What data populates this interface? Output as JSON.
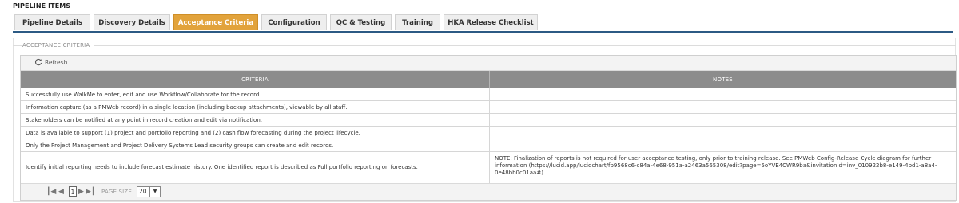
{
  "page": {
    "title": "PIPELINE ITEMS"
  },
  "tabs": [
    {
      "label": "Pipeline Details",
      "active": false
    },
    {
      "label": "Discovery Details",
      "active": false
    },
    {
      "label": "Acceptance Criteria",
      "active": true
    },
    {
      "label": "Configuration",
      "active": false
    },
    {
      "label": "QC & Testing",
      "active": false
    },
    {
      "label": "Training",
      "active": false
    },
    {
      "label": "HKA Release Checklist",
      "active": false
    }
  ],
  "section": {
    "title": "ACCEPTANCE CRITERIA"
  },
  "toolbar": {
    "refresh_label": "Refresh",
    "refresh_icon": "refresh-icon"
  },
  "grid": {
    "columns": [
      "CRITERIA",
      "NOTES"
    ],
    "rows": [
      {
        "criteria": "Successfully use WalkMe to enter, edit and use Workflow/Collaborate for the record.",
        "notes": ""
      },
      {
        "criteria": "Information capture (as a PMWeb record) in a single location (including backup attachments), viewable by all staff.",
        "notes": ""
      },
      {
        "criteria": "Stakeholders can be notified at any point in record creation and edit via notification.",
        "notes": ""
      },
      {
        "criteria": "Data is available to support (1) project and portfolio reporting and (2) cash flow forecasting during the project lifecycle.",
        "notes": ""
      },
      {
        "criteria": "Only the Project Management and Project Delivery Systems Lead security groups can create and edit records.",
        "notes": ""
      },
      {
        "criteria": "Identify initial reporting needs to include forecast estimate history. One identified report is described as Full portfolio reporting on forecasts.",
        "notes": "NOTE: Finalization of reports is not required for user acceptance testing, only prior to training release. See PMWeb Config-Release Cycle diagram for further information (https://lucid.app/lucidchart/fb9568c6-c84a-4e68-951a-a2463a565308/edit?page=5oYVE4CWR9ba&invitationId=inv_010922b8-e149-4bd1-a8a4-0e48bb0c01aa#)"
      }
    ]
  },
  "pager": {
    "current_page": "1",
    "page_size_label": "PAGE SIZE",
    "page_size": "20",
    "first_icon": "first-page-icon",
    "prev_icon": "prev-page-icon",
    "next_icon": "next-page-icon",
    "last_icon": "last-page-icon"
  },
  "colors": {
    "active_tab": "#e2a33b",
    "tab_underline": "#2c5a84",
    "grid_header": "#8c8c8c"
  }
}
